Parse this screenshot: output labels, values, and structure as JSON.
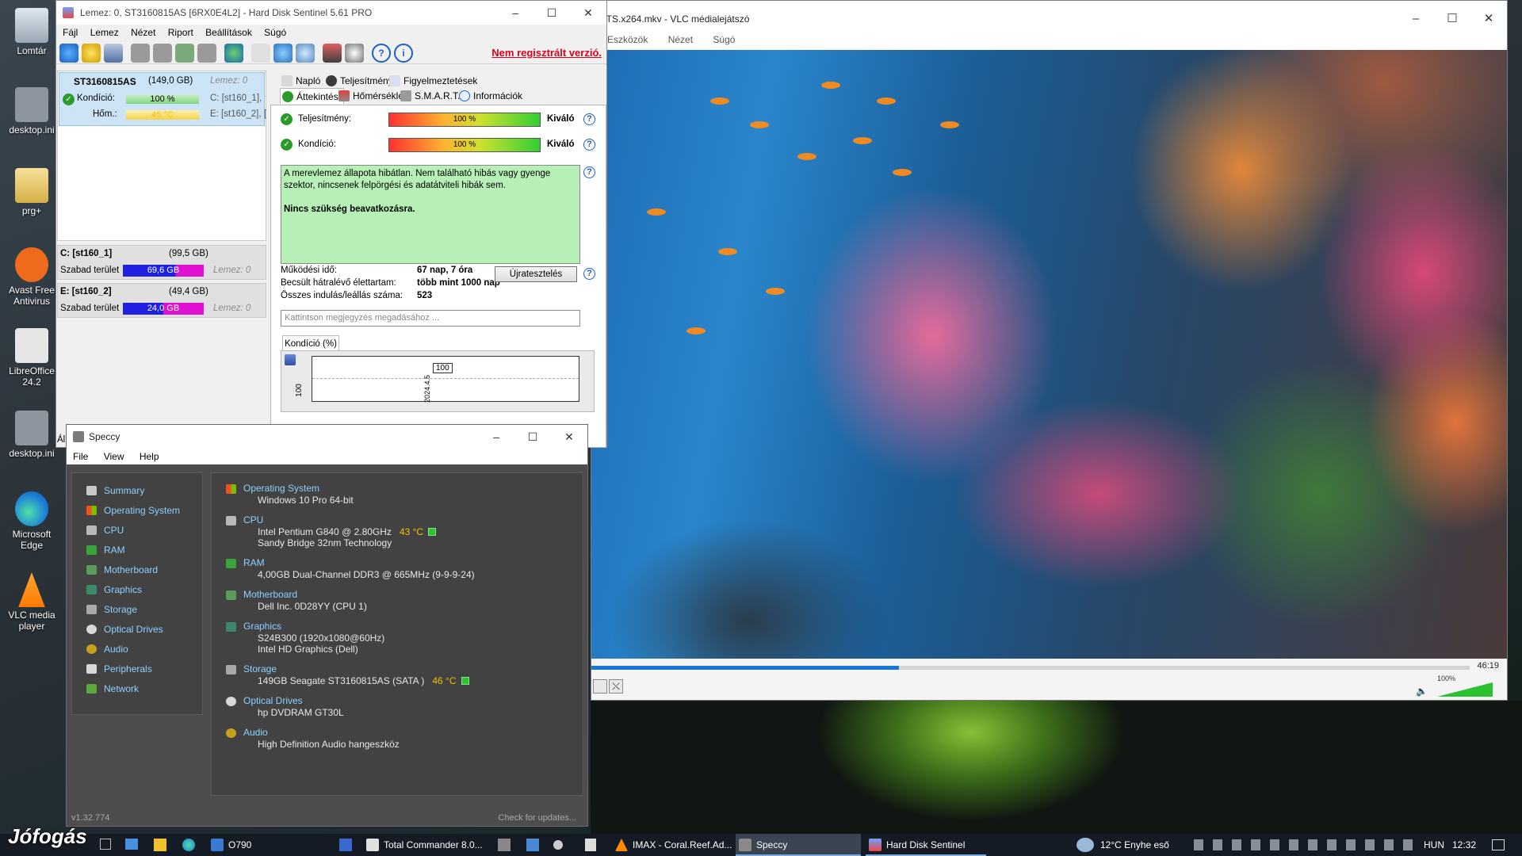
{
  "desktop": {
    "icons": [
      {
        "label": "Lomtár"
      },
      {
        "label": "desktop.ini"
      },
      {
        "label": "prg+"
      },
      {
        "label": "Avast Free Antivirus"
      },
      {
        "label": "LibreOffice 24.2"
      },
      {
        "label": "desktop.ini"
      },
      {
        "label": "Microsoft Edge"
      },
      {
        "label": "VLC media player"
      }
    ]
  },
  "vlc": {
    "title": "DTS.x264.mkv - VLC médialejátszó",
    "menu": [
      "Eszközök",
      "Nézet",
      "Súgó"
    ],
    "time": "46:19",
    "progress": 0.35,
    "volume_label": "100%"
  },
  "hds": {
    "title": "Lemez: 0, ST3160815AS [6RX0E4L2]  -  Hard Disk Sentinel 5.61 PRO",
    "menu": [
      "Fájl",
      "Lemez",
      "Nézet",
      "Riport",
      "Beállítások",
      "Súgó"
    ],
    "unregistered": "Nem regisztrált verzió.",
    "disk": {
      "model": "ST3160815AS",
      "size": "(149,0 GB)",
      "disk_no": "Lemez: 0",
      "health_label": "Kondíció:",
      "health_value": "100 %",
      "temp_label": "Hőm.:",
      "temp_value": "45 °C",
      "part_c": "C: [st160_1],",
      "part_e": "E: [st160_2],",
      "bracket": "["
    },
    "partitions": [
      {
        "name": "C: [st160_1]",
        "size": "(99,5 GB)",
        "free_label": "Szabad terület",
        "free": "69,6 GB",
        "disk": "Lemez: 0"
      },
      {
        "name": "E: [st160_2]",
        "size": "(49,4 GB)",
        "free_label": "Szabad terület",
        "free": "24,0 GB",
        "disk": "Lemez: 0"
      }
    ],
    "status_cut": "Áll",
    "tabs_row1": [
      "Napló",
      "Teljesítmény",
      "Figyelmeztetések"
    ],
    "tabs_row2": [
      "Áttekintés",
      "Hőmérséklet",
      "S.M.A.R.T.",
      "Információk"
    ],
    "performance": {
      "label": "Teljesítmény:",
      "value": "100 %",
      "rating": "Kiváló",
      "level": 1.0
    },
    "health": {
      "label": "Kondíció:",
      "value": "100 %",
      "rating": "Kiváló",
      "level": 1.0
    },
    "message": "A merevlemez állapota hibátlan. Nem található hibás vagy gyenge szektor, nincsenek felpörgési és adatátviteli hibák sem.",
    "message_bold": "Nincs szükség beavatkozásra.",
    "stats": [
      {
        "label": "Működési idő:",
        "value": "67 nap, 7 óra"
      },
      {
        "label": "Becsült hátralévő élettartam:",
        "value": "több mint 1000 nap"
      },
      {
        "label": "Összes indulás/leállás száma:",
        "value": "523"
      }
    ],
    "retest": "Újratesztelés",
    "note_placeholder": "Kattintson megjegyzés megadásához ...",
    "chart_tab": "Kondíció  (%)",
    "chart_y": "100",
    "chart_point": "100",
    "chart_date": "2024.4.5"
  },
  "speccy": {
    "title": "Speccy",
    "menu": [
      "File",
      "View",
      "Help"
    ],
    "sidebar": [
      "Summary",
      "Operating System",
      "CPU",
      "RAM",
      "Motherboard",
      "Graphics",
      "Storage",
      "Optical Drives",
      "Audio",
      "Peripherals",
      "Network"
    ],
    "sections": [
      {
        "head": "Operating System",
        "lines": [
          "Windows 10 Pro 64-bit"
        ]
      },
      {
        "head": "CPU",
        "lines": [
          "Intel Pentium G840 @ 2.80GHz",
          "Sandy Bridge 32nm Technology"
        ],
        "temp": "43 °C"
      },
      {
        "head": "RAM",
        "lines": [
          "4,00GB Dual-Channel DDR3 @ 665MHz (9-9-9-24)"
        ]
      },
      {
        "head": "Motherboard",
        "lines": [
          "Dell Inc. 0D28YY (CPU 1)"
        ]
      },
      {
        "head": "Graphics",
        "lines": [
          "S24B300 (1920x1080@60Hz)",
          "Intel HD Graphics (Dell)"
        ]
      },
      {
        "head": "Storage",
        "lines": [
          "149GB Seagate ST3160815AS (SATA )"
        ],
        "temp": "46 °C"
      },
      {
        "head": "Optical Drives",
        "lines": [
          "hp DVDRAM GT30L"
        ]
      },
      {
        "head": "Audio",
        "lines": [
          "High Definition Audio hangeszköz"
        ]
      }
    ],
    "version": "v1.32.774",
    "check_updates": "Check for updates..."
  },
  "taskbar": {
    "watermark": "Jófogás",
    "items": [
      {
        "label": "O790"
      },
      {
        "label": "Total Commander 8.0..."
      },
      {
        "label": "IMAX - Coral.Reef.Ad..."
      },
      {
        "label": "Speccy"
      },
      {
        "label": "Hard Disk Sentinel"
      }
    ],
    "weather": "12°C  Enyhe eső",
    "lang": "HUN",
    "clock": "12:32"
  }
}
